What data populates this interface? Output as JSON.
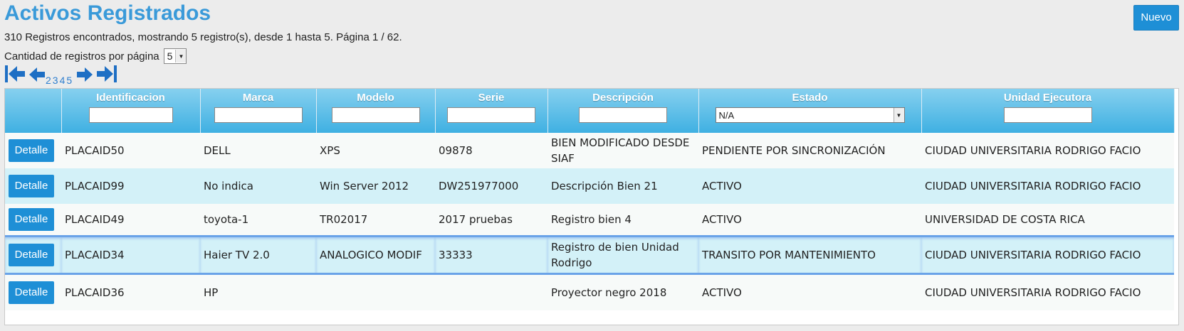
{
  "page": {
    "title": "Activos Registrados",
    "new_button": "Nuevo",
    "summary": "310 Registros encontrados, mostrando 5 registro(s), desde 1 hasta 5. Página 1 / 62.",
    "per_page_label": "Cantidad de registros por página",
    "per_page_value": "5"
  },
  "pager": {
    "pages": [
      "2",
      "3",
      "4",
      "5"
    ],
    "icons": [
      "first-page-icon",
      "previous-page-icon",
      "next-page-icon",
      "last-page-icon"
    ]
  },
  "table": {
    "columns": [
      "",
      "Identificacion",
      "Marca",
      "Modelo",
      "Serie",
      "Descripción",
      "Estado",
      "Unidad Ejecutora"
    ],
    "estado_filter": "N/A",
    "detail_label": "Detalle",
    "rows": [
      [
        "PLACAID50",
        "DELL",
        "XPS",
        "09878",
        "BIEN MODIFICADO DESDE SIAF",
        "PENDIENTE POR SINCRONIZACIÓN",
        "CIUDAD UNIVERSITARIA RODRIGO FACIO"
      ],
      [
        "PLACAID99",
        "No indica",
        "Win Server 2012",
        "DW251977000",
        "Descripción Bien 21",
        "ACTIVO",
        "CIUDAD UNIVERSITARIA RODRIGO FACIO"
      ],
      [
        "PLACAID49",
        "toyota-1",
        "TR02017",
        "2017 pruebas",
        "Registro bien 4",
        "ACTIVO",
        "UNIVERSIDAD DE COSTA RICA"
      ],
      [
        "PLACAID34",
        "Haier TV 2.0",
        "ANALOGICO MODIF",
        "33333",
        "Registro de bien Unidad Rodrigo",
        "TRANSITO POR MANTENIMIENTO",
        "CIUDAD UNIVERSITARIA RODRIGO FACIO"
      ],
      [
        "PLACAID36",
        "HP",
        "",
        "",
        "Proyector negro 2018",
        "ACTIVO",
        "CIUDAD UNIVERSITARIA RODRIGO FACIO"
      ]
    ]
  },
  "colors": {
    "accent": "#1e8fd6",
    "title": "#3a9ad9",
    "header_top": "#86d0ef",
    "header_bottom": "#3fb0e2",
    "row_alt": "#d3f1f8"
  }
}
